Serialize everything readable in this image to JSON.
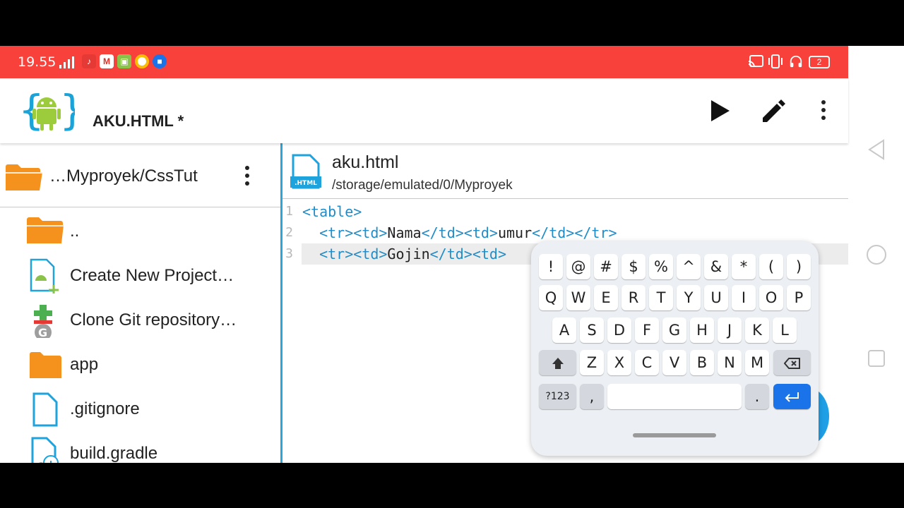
{
  "status_bar": {
    "time": "19.55",
    "battery": "2"
  },
  "app_bar": {
    "title": "AKU.HTML *",
    "run_icon": "play-icon",
    "edit_icon": "pencil-icon",
    "more_icon": "more-vert-icon"
  },
  "file_browser": {
    "path": "…Myproyek/CssTut",
    "items": [
      {
        "label": "..",
        "icon": "folder-icon"
      },
      {
        "label": "Create New Project…",
        "icon": "new-project-icon"
      },
      {
        "label": "Clone Git repository…",
        "icon": "git-icon"
      },
      {
        "label": "app",
        "icon": "folder-icon"
      },
      {
        "label": ".gitignore",
        "icon": "file-icon"
      },
      {
        "label": "build.gradle",
        "icon": "gradle-file-icon"
      }
    ]
  },
  "editor": {
    "file_name": "aku.html",
    "file_path": "/storage/emulated/0/Myproyek",
    "file_icon_label": ".HTML",
    "lines": [
      {
        "num": "1",
        "parts": [
          {
            "t": "tag",
            "v": "<table>"
          }
        ]
      },
      {
        "num": "2",
        "parts": [
          {
            "t": "tag",
            "v": "  <tr><td>"
          },
          {
            "t": "txt",
            "v": "Nama"
          },
          {
            "t": "tag",
            "v": "</td><td>"
          },
          {
            "t": "txt",
            "v": "umur"
          },
          {
            "t": "tag",
            "v": "</td></tr>"
          }
        ]
      },
      {
        "num": "3",
        "parts": [
          {
            "t": "tag",
            "v": "  <tr><td>"
          },
          {
            "t": "txt",
            "v": "Gojin"
          },
          {
            "t": "tag",
            "v": "</td><td>"
          }
        ]
      }
    ]
  },
  "keyboard": {
    "row1": [
      "!",
      "@",
      "#",
      "$",
      "%",
      "^",
      "&",
      "*",
      "(",
      ")"
    ],
    "row2": [
      "Q",
      "W",
      "E",
      "R",
      "T",
      "Y",
      "U",
      "I",
      "O",
      "P"
    ],
    "row3": [
      "A",
      "S",
      "D",
      "F",
      "G",
      "H",
      "J",
      "K",
      "L"
    ],
    "row4": [
      "Z",
      "X",
      "C",
      "V",
      "B",
      "N",
      "M"
    ],
    "symbols_key": "?123",
    "comma_key": ",",
    "period_key": ".",
    "shift_icon": "shift-icon",
    "backspace_icon": "backspace-icon",
    "enter_icon": "enter-icon"
  },
  "colors": {
    "status_bar": "#f8413b",
    "accent": "#2aa6dc",
    "tag": "#1f8dc9",
    "enter_key": "#1a73e8",
    "folder": "#f5921e"
  }
}
